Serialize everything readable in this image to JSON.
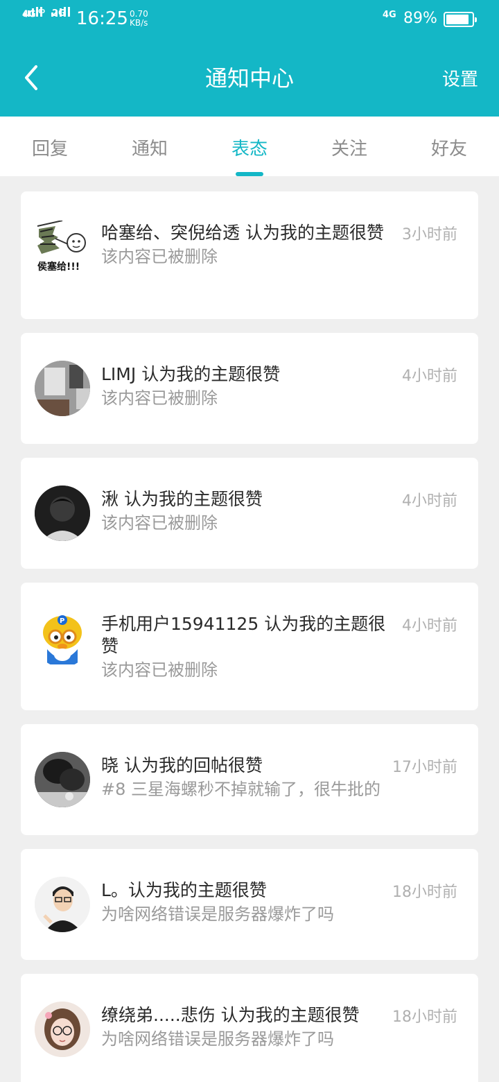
{
  "status_bar": {
    "signal1": "4G",
    "signal1_sup": "HD",
    "signal2": "2G",
    "time": "16:25",
    "speed_value": "0.70",
    "speed_unit": "KB/s",
    "network": "4G",
    "battery_percent": "89%",
    "battery_level": 0.89
  },
  "header": {
    "title": "通知中心",
    "settings_label": "设置",
    "accent_color": "#14b7c6"
  },
  "tabs": [
    {
      "label": "回复",
      "active": false
    },
    {
      "label": "通知",
      "active": false
    },
    {
      "label": "表态",
      "active": true
    },
    {
      "label": "关注",
      "active": false
    },
    {
      "label": "好友",
      "active": false
    }
  ],
  "notifications": [
    {
      "name": "哈塞给、突倪给透 认为我的主题很赞",
      "subtitle": "该内容已被删除",
      "time": "3小时前",
      "avatar_caption": "侯塞给!!!"
    },
    {
      "name": "LIMJ 认为我的主题很赞",
      "subtitle": "该内容已被删除",
      "time": "4小时前"
    },
    {
      "name": "湫 认为我的主题很赞",
      "subtitle": "该内容已被删除",
      "time": "4小时前"
    },
    {
      "name": "手机用户15941125 认为我的主题很赞",
      "subtitle": "该内容已被删除",
      "time": "4小时前"
    },
    {
      "name": "晓 认为我的回帖很赞",
      "subtitle": "#8 三星海螺秒不掉就输了，很牛批的",
      "time": "17小时前"
    },
    {
      "name": "L。认为我的主题很赞",
      "subtitle": "为啥网络错误是服务器爆炸了吗",
      "time": "18小时前"
    },
    {
      "name": "缭绕弟.....悲伤 认为我的主题很赞",
      "subtitle": "为啥网络错误是服务器爆炸了吗",
      "time": "18小时前"
    }
  ]
}
